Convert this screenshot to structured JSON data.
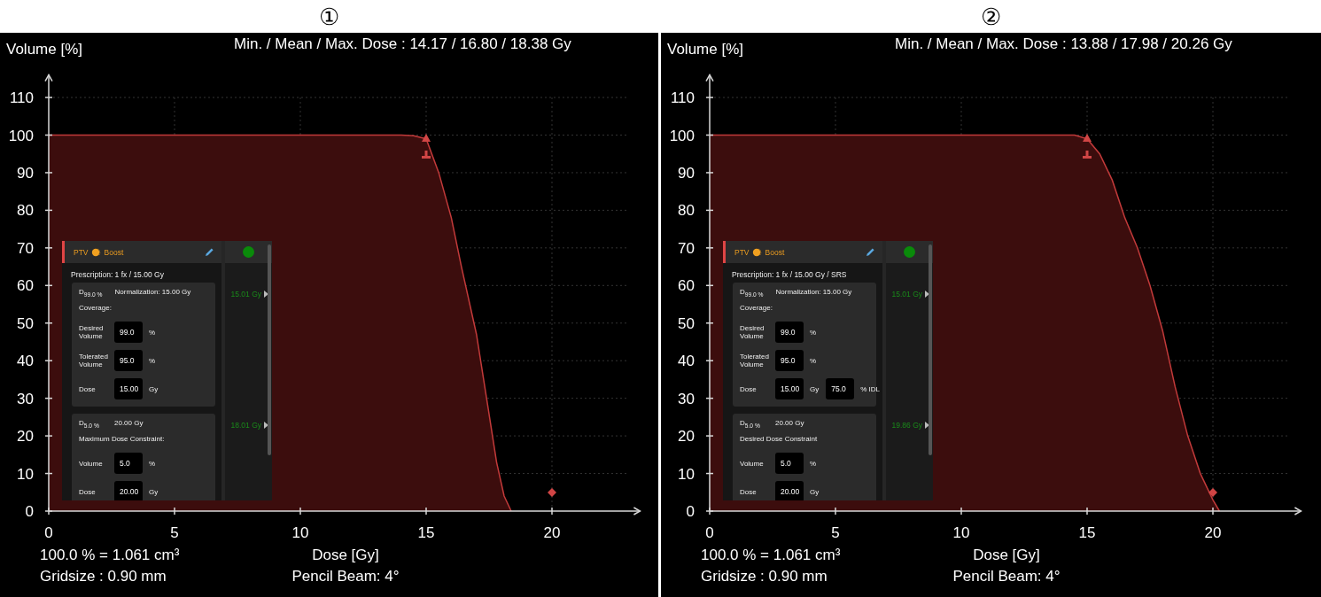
{
  "panels": [
    {
      "number": "①",
      "stats": "Min. / Mean / Max. Dose : 14.17 / 16.80 / 18.38 Gy",
      "volume_note": "100.0 % = 1.061 cm³",
      "gridsize": "Gridsize : 0.90 mm",
      "algorithm": "Pencil Beam: 4°",
      "chart_data": {
        "type": "area",
        "xlabel": "Dose [Gy]",
        "ylabel": "Volume [%]",
        "x": [
          0,
          14,
          14.5,
          15,
          15.5,
          16,
          16.4,
          17,
          17.4,
          17.8,
          18.1,
          18.38
        ],
        "values": [
          100,
          100,
          99.8,
          99,
          90,
          78,
          65,
          47,
          30,
          13,
          4,
          0
        ],
        "xlim": [
          0,
          23.5
        ],
        "ylim": [
          0,
          116
        ],
        "xticks": [
          0,
          5,
          10,
          15,
          20
        ],
        "yticks": [
          0,
          10,
          20,
          30,
          40,
          50,
          60,
          70,
          80,
          90,
          100,
          110
        ],
        "grid": true
      },
      "constraint_panel": {
        "structure": "PTV",
        "name": "Boost",
        "passed": true,
        "prescription": "Prescription: 1 fx / 15.00 Gy",
        "objectives": [
          {
            "metric": "D$_{99.0 %}$",
            "value": "Normalization: 15.00 Gy",
            "achieved": "15.01 Gy",
            "title": "Coverage:",
            "rows": [
              {
                "label": "Desired Volume",
                "fields": [
                  {
                    "value": "99.0",
                    "unit": "%"
                  }
                ]
              },
              {
                "label": "Tolerated Volume",
                "fields": [
                  {
                    "value": "95.0",
                    "unit": "%"
                  }
                ]
              },
              {
                "label": "Dose",
                "fields": [
                  {
                    "value": "15.00",
                    "unit": "Gy"
                  }
                ]
              }
            ]
          },
          {
            "metric": "D$_{5.0 %}$",
            "value": "20.00 Gy",
            "achieved": "18.01 Gy",
            "title": "Maximum Dose Constraint:",
            "rows": [
              {
                "label": "Volume",
                "fields": [
                  {
                    "value": "5.0",
                    "unit": "%"
                  }
                ]
              },
              {
                "label": "Dose",
                "fields": [
                  {
                    "value": "20.00",
                    "unit": "Gy"
                  }
                ]
              }
            ]
          }
        ]
      }
    },
    {
      "number": "②",
      "stats": "Min. / Mean / Max. Dose : 13.88 / 17.98 / 20.26 Gy",
      "volume_note": "100.0 % = 1.061 cm³",
      "gridsize": "Gridsize : 0.90 mm",
      "algorithm": "Pencil Beam: 4°",
      "chart_data": {
        "type": "area",
        "xlabel": "Dose [Gy]",
        "ylabel": "Volume [%]",
        "x": [
          0,
          14.5,
          15,
          15.5,
          16,
          16.5,
          17,
          17.5,
          18,
          18.5,
          19,
          19.5,
          20,
          20.26
        ],
        "values": [
          100,
          100,
          99,
          95,
          88,
          78,
          70,
          60,
          48,
          33,
          20,
          10,
          3,
          0
        ],
        "xlim": [
          0,
          23.5
        ],
        "ylim": [
          0,
          116
        ],
        "xticks": [
          0,
          5,
          10,
          15,
          20
        ],
        "yticks": [
          0,
          10,
          20,
          30,
          40,
          50,
          60,
          70,
          80,
          90,
          100,
          110
        ],
        "grid": true
      },
      "constraint_panel": {
        "structure": "PTV",
        "name": "Boost",
        "passed": true,
        "prescription": "Prescription: 1 fx / 15.00 Gy / SRS",
        "objectives": [
          {
            "metric": "D$_{99.0 %}$",
            "value": "Normalization: 15.00 Gy",
            "achieved": "15.01 Gy",
            "title": "Coverage:",
            "rows": [
              {
                "label": "Desired Volume",
                "fields": [
                  {
                    "value": "99.0",
                    "unit": "%"
                  }
                ]
              },
              {
                "label": "Tolerated Volume",
                "fields": [
                  {
                    "value": "95.0",
                    "unit": "%"
                  }
                ]
              },
              {
                "label": "Dose",
                "fields": [
                  {
                    "value": "15.00",
                    "unit": "Gy"
                  },
                  {
                    "value": "75.0",
                    "unit": "% IDL"
                  }
                ]
              }
            ]
          },
          {
            "metric": "D$_{5.0 %}$",
            "value": "20.00 Gy",
            "achieved": "19.86 Gy",
            "title": "Desired Dose Constraint",
            "rows": [
              {
                "label": "Volume",
                "fields": [
                  {
                    "value": "5.0",
                    "unit": "%"
                  }
                ]
              },
              {
                "label": "Dose",
                "fields": [
                  {
                    "value": "20.00",
                    "unit": "Gy"
                  }
                ]
              }
            ]
          }
        ]
      }
    }
  ]
}
